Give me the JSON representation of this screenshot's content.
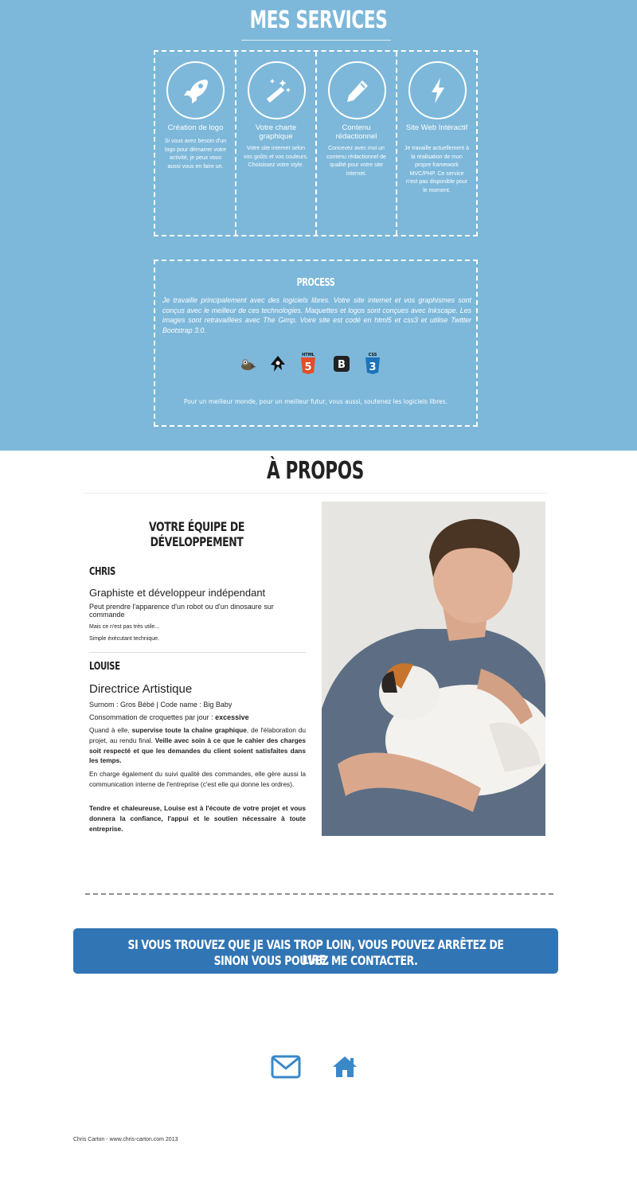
{
  "services": {
    "title": "MES SERVICES",
    "items": [
      {
        "icon": "rocket-icon",
        "name": "Création de logo",
        "description": "Si vous avez besoin d'un logo pour démarrer votre activité, je peux vous aussi vous en faire un."
      },
      {
        "icon": "magic-wand-icon",
        "name": "Votre charte graphique",
        "description": "Votre site internet selon vos goûts et vos couleurs. Choisissez votre style."
      },
      {
        "icon": "pencil-icon",
        "name": "Contenu rédactionnel",
        "description": "Concevez avec moi un contenu rédactionnel de qualité pour votre site internet."
      },
      {
        "icon": "lightning-icon",
        "name": "Site Web Intéractif",
        "description": "Je travaille actuellement à la réalisation de mon propre framework MVC/PHP. Ce service n'est pas disponible pour le moment."
      }
    ]
  },
  "process": {
    "title": "PROCESS",
    "text": "Je travaille principalement avec des logiciels libres. Votre site internet et vos graphismes sont conçus avec le meilleur de ces technologies. Maquettes et logos sont conçues avec Inkscape. Les images sont retravaillées avec The Gimp. Voire site est codé en html5 et css3 et utilise Twitter Bootstrap 3.0.",
    "logos": [
      {
        "icon": "gimp-logo-icon"
      },
      {
        "icon": "inkscape-logo-icon"
      },
      {
        "icon": "html5-logo-icon",
        "label": "HTML",
        "glyph": "5"
      },
      {
        "icon": "bootstrap-logo-icon",
        "glyph": "B"
      },
      {
        "icon": "css3-logo-icon",
        "label": "CSS",
        "glyph": "3"
      }
    ],
    "footer": "Pour un meilleur monde, pour un meilleur futur, vous aussi, soutenez les logiciels libres."
  },
  "about": {
    "title": "À PROPOS",
    "team_title": "VOTRE ÉQUIPE DE DÉVELOPPEMENT",
    "chris": {
      "name": "CHRIS",
      "role": "Graphiste et développeur indépendant",
      "line1": "Peut prendre l'apparence d'un robot ou d'un dinosaure sur commande",
      "line2": "Mais ce n'est pas très utile...",
      "line3": "Simple éxécutant technique."
    },
    "louise": {
      "name": "LOUISE",
      "role": "Directrice Artistique",
      "nickname": "Surnom : Gros Bébé | Code name : Big Baby",
      "croquettes_label": "Consommation de croquettes par jour :",
      "croquettes_value": "excessive",
      "p1_a": "Quand à elle,",
      "p1_b": "supervise toute la chaîne graphique",
      "p1_c": ", de l'élaboration du projet, au rendu final.",
      "p1_d": "Veille avec soin à ce que le cahier des charges soit respecté et que les demandes du client soient satisfaites dans les temps.",
      "p2": "En charge également du suivi qualité des commandes, elle gère aussi la communication interne de l'entreprise (c'est elle qui donne les ordres).",
      "p3": "Tendre et chaleureuse, Louise est à l'écoute de votre projet et vous donnera la confiance, l'appui et le soutien nécessaire à toute entreprise."
    }
  },
  "cta": {
    "line1": "SI VOUS TROUVEZ QUE JE VAIS TROP LOIN, VOUS POUVEZ ARRÊTEZ DE LIRE.",
    "line2": "SINON VOUS POUVEZ ME CONTACTER."
  },
  "contact_icons": [
    "envelope-icon",
    "home-icon"
  ],
  "footer": "Chris Carton - www.chris-carton.com 2013",
  "colors": {
    "services_bg": "#7db8da",
    "cta_bg": "#3175b4",
    "icon_blue": "#3a88c8"
  }
}
